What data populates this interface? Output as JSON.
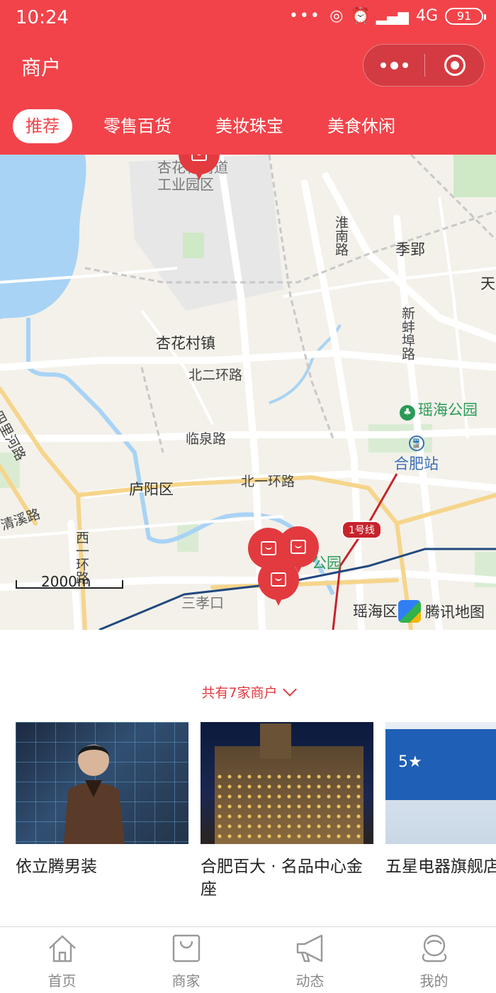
{
  "status_bar": {
    "time": "10:24",
    "network": "4G",
    "battery": "91"
  },
  "nav": {
    "title": "商户"
  },
  "tabs": [
    "推荐",
    "零售百货",
    "美妆珠宝",
    "美食休闲"
  ],
  "map": {
    "labels": {
      "gongye": "杏花村街道\n工业园区",
      "huainan": "淮南路",
      "jiying": "季郢",
      "tian": "天",
      "xinbengbu": "新蚌埠路",
      "xinghuacun": "杏花村镇",
      "beier": "北二环路",
      "yaohai_park": "瑶海公园",
      "silihe": "四里河路",
      "linquan": "临泉路",
      "hefei_station": "合肥站",
      "luyang": "庐阳区",
      "beiyi": "北一环路",
      "qingxi": "清溪路",
      "xiyihuan": "西一环路",
      "metro_line": "1号线",
      "park2": "公园",
      "sanxiaokou": "三孝口",
      "yaohai_district": "瑶海区",
      "brand": "腾讯地图"
    },
    "scale": "2000m"
  },
  "merchants": {
    "count_text": "共有7家商户",
    "items": [
      {
        "name": "依立腾男装",
        "image": "menswear-model-photo"
      },
      {
        "name": "合肥百大 · 名品中心金座",
        "image": "department-store-night-photo"
      },
      {
        "name": "五星电器旗舰店",
        "image": "electronics-store-photo"
      }
    ]
  },
  "bottom_nav": [
    {
      "label": "首页",
      "icon": "home-icon"
    },
    {
      "label": "商家",
      "icon": "shopping-bag-icon"
    },
    {
      "label": "动态",
      "icon": "megaphone-icon"
    },
    {
      "label": "我的",
      "icon": "user-icon"
    }
  ],
  "colors": {
    "brand_red": "#f2434a",
    "water": "#a8d3f5",
    "road": "#ffffff",
    "park": "#cfe8c6"
  }
}
